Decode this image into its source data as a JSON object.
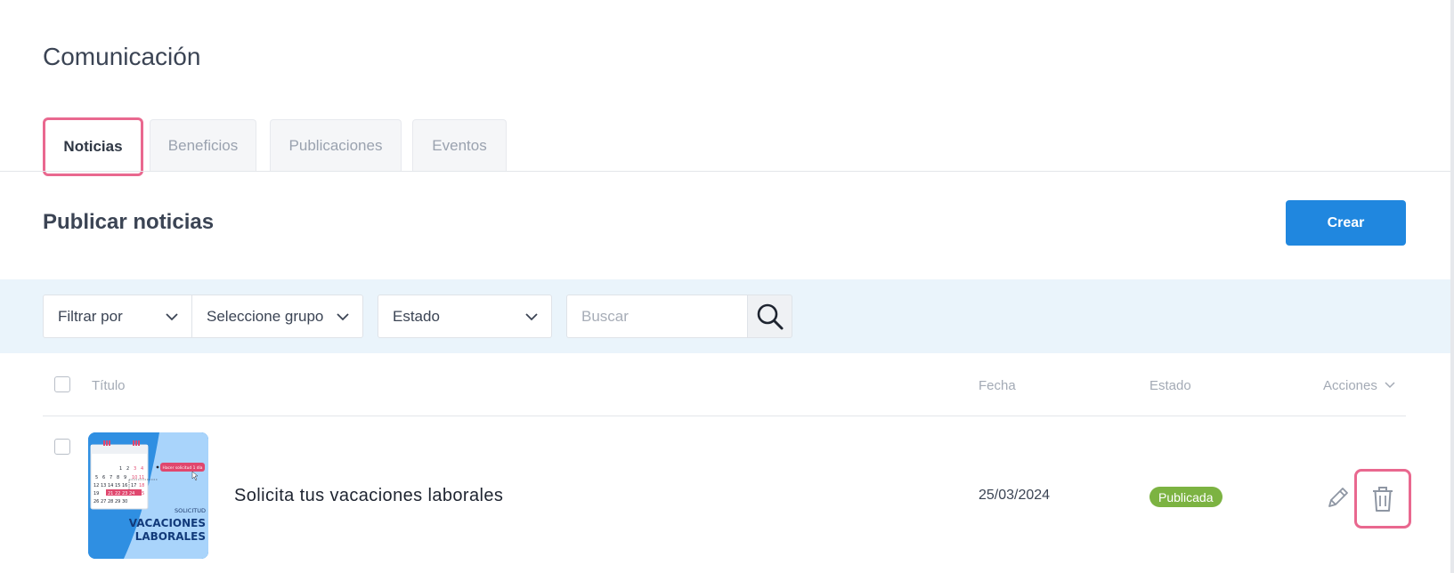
{
  "page": {
    "title": "Comunicación"
  },
  "tabs": [
    {
      "label": "Noticias",
      "active": true
    },
    {
      "label": "Beneficios",
      "active": false
    },
    {
      "label": "Publicaciones",
      "active": false
    },
    {
      "label": "Eventos",
      "active": false
    }
  ],
  "section": {
    "title": "Publicar noticias",
    "create_label": "Crear"
  },
  "filters": {
    "filter_by": "Filtrar por",
    "group": "Seleccione grupo",
    "status": "Estado",
    "search_placeholder": "Buscar"
  },
  "table": {
    "headers": {
      "title": "Título",
      "date": "Fecha",
      "status": "Estado",
      "actions": "Acciones"
    },
    "rows": [
      {
        "title": "Solicita tus vacaciones laborales",
        "date": "25/03/2024",
        "status": "Publicada",
        "thumbnail": {
          "label_small": "SOLICITUD",
          "label_line1": "VACACIONES",
          "label_line2": "LABORALES",
          "callout": "Hacer solicitud 1 día"
        }
      }
    ]
  },
  "colors": {
    "accent": "#2087df",
    "highlight": "#e9688f",
    "status_published": "#7cb342",
    "filter_bar": "#eaf4fb"
  },
  "icons": {
    "chevron": "chevron-down-icon",
    "search": "search-icon",
    "edit": "pencil-icon",
    "delete": "trash-icon"
  }
}
